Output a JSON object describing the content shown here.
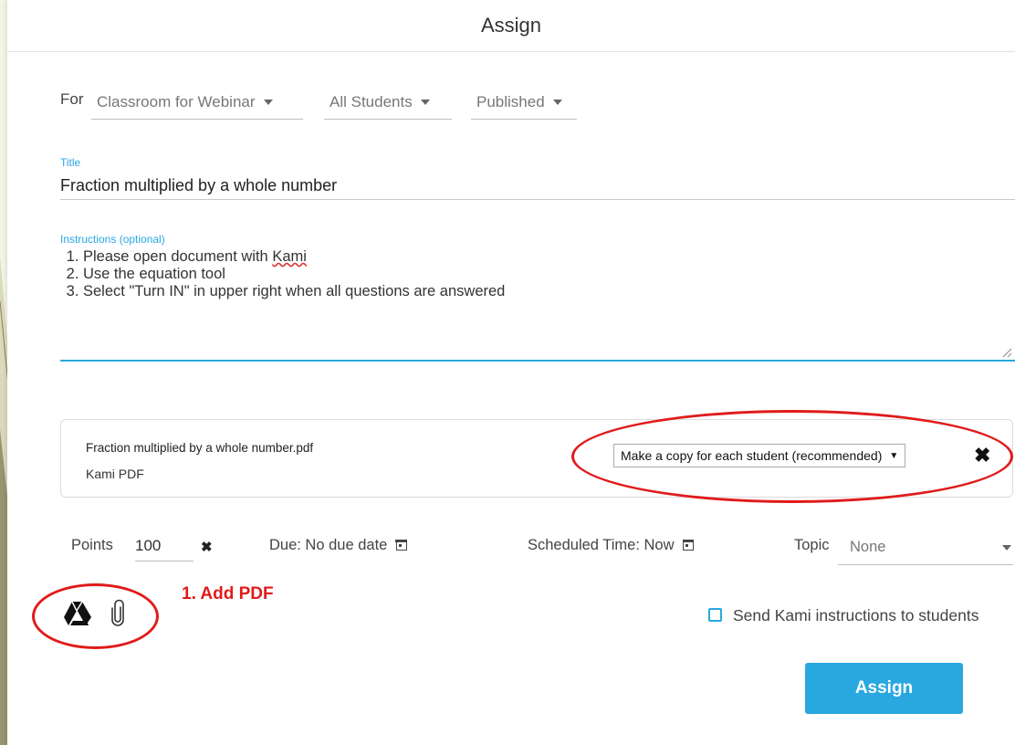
{
  "header": {
    "title": "Assign"
  },
  "for_row": {
    "label": "For",
    "classroom": "Classroom for Webinar",
    "audience": "All Students",
    "status": "Published"
  },
  "title_field": {
    "label": "Title",
    "value": "Fraction multiplied by a whole number"
  },
  "instructions_field": {
    "label": "Instructions (optional)",
    "lines": [
      "Please open document with ",
      "Use the equation tool",
      "Select \"Turn IN\" in upper right when all questions are answered"
    ],
    "line1_underlined_word": "Kami"
  },
  "attachment": {
    "file_name": "Fraction multiplied by a whole number.pdf",
    "file_type": "Kami PDF",
    "share_mode": "Make a copy for each student (recommended)"
  },
  "settings_row": {
    "points_label": "Points",
    "points_value": "100",
    "due_label": "Due: No due date",
    "scheduled_label": "Scheduled Time: Now",
    "topic_label": "Topic",
    "topic_value": "None"
  },
  "annotation": {
    "text": "1. Add PDF"
  },
  "send_instructions": {
    "label": "Send Kami instructions to students",
    "checked": false
  },
  "assign_button": {
    "label": "Assign"
  },
  "icons": [
    "google-drive-icon",
    "paperclip-icon",
    "remove-x-icon",
    "calendar-icon",
    "caret-down-icon",
    "resize-grip-icon"
  ],
  "colors": {
    "accent": "#29a8e0",
    "annotation_red": "#e01b1b",
    "page_background": "#f2f4e4"
  }
}
